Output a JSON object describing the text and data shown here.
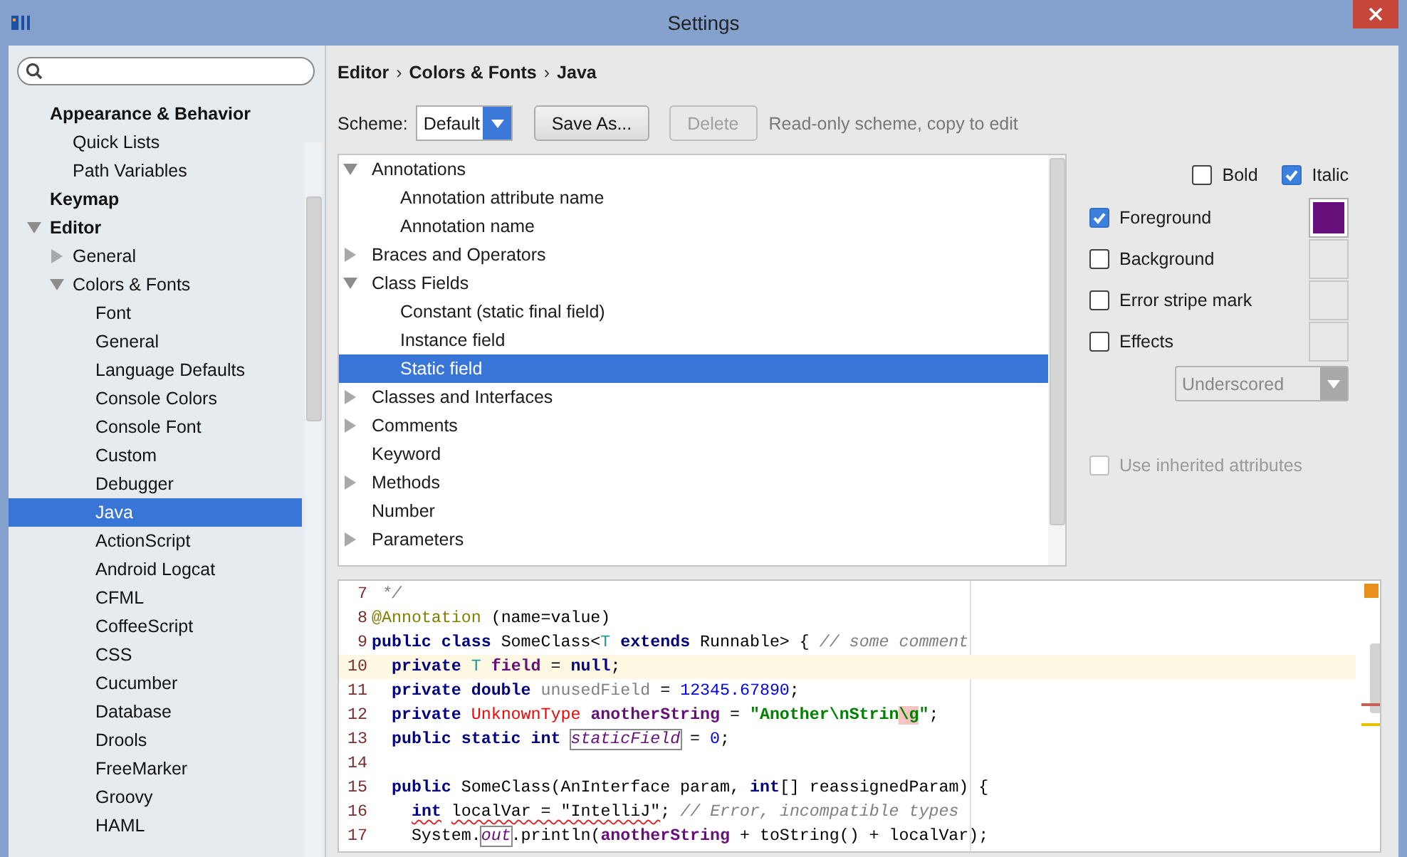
{
  "window": {
    "title": "Settings"
  },
  "sidebar": {
    "items": [
      {
        "label": "Appearance & Behavior",
        "selected": false,
        "children": [
          {
            "label": "Quick Lists",
            "selected": false
          },
          {
            "label": "Path Variables",
            "selected": false
          }
        ]
      },
      {
        "label": "Keymap",
        "selected": false
      },
      {
        "label": "Editor",
        "selected": false,
        "expanded": true,
        "children": [
          {
            "label": "General",
            "selected": false,
            "expanded": false
          },
          {
            "label": "Colors & Fonts",
            "selected": false,
            "expanded": true,
            "children": [
              {
                "label": "Font",
                "selected": false
              },
              {
                "label": "General",
                "selected": false
              },
              {
                "label": "Language Defaults",
                "selected": false
              },
              {
                "label": "Console Colors",
                "selected": false
              },
              {
                "label": "Console Font",
                "selected": false
              },
              {
                "label": "Custom",
                "selected": false
              },
              {
                "label": "Debugger",
                "selected": false
              },
              {
                "label": "Java",
                "selected": true
              },
              {
                "label": "ActionScript",
                "selected": false
              },
              {
                "label": "Android Logcat",
                "selected": false
              },
              {
                "label": "CFML",
                "selected": false
              },
              {
                "label": "CoffeeScript",
                "selected": false
              },
              {
                "label": "CSS",
                "selected": false
              },
              {
                "label": "Cucumber",
                "selected": false
              },
              {
                "label": "Database",
                "selected": false
              },
              {
                "label": "Drools",
                "selected": false
              },
              {
                "label": "FreeMarker",
                "selected": false
              },
              {
                "label": "Groovy",
                "selected": false
              },
              {
                "label": "HAML",
                "selected": false
              }
            ]
          }
        ]
      }
    ]
  },
  "breadcrumb": {
    "items": [
      "Editor",
      "Colors & Fonts",
      "Java"
    ],
    "separator": "›"
  },
  "scheme": {
    "label": "Scheme:",
    "value": "Default",
    "buttons": [
      {
        "label": "Save As...",
        "disabled": false
      },
      {
        "label": "Delete",
        "disabled": true
      }
    ],
    "hint": "Read-only scheme, copy to edit"
  },
  "attribute_tree": {
    "items": [
      {
        "label": "Annotations",
        "selected": false,
        "expanded": true,
        "children": [
          {
            "label": "Annotation attribute name",
            "selected": false
          },
          {
            "label": "Annotation name",
            "selected": false
          }
        ]
      },
      {
        "label": "Braces and Operators",
        "selected": false,
        "expanded": false
      },
      {
        "label": "Class Fields",
        "selected": false,
        "expanded": true,
        "children": [
          {
            "label": "Constant (static final field)",
            "selected": false
          },
          {
            "label": "Instance field",
            "selected": false
          },
          {
            "label": "Static field",
            "selected": true
          }
        ]
      },
      {
        "label": "Classes and Interfaces",
        "selected": false,
        "expanded": false
      },
      {
        "label": "Comments",
        "selected": false,
        "expanded": false
      },
      {
        "label": "Keyword",
        "selected": false
      },
      {
        "label": "Methods",
        "selected": false,
        "expanded": false
      },
      {
        "label": "Number",
        "selected": false
      },
      {
        "label": "Parameters",
        "selected": false,
        "expanded": false
      }
    ]
  },
  "attributes": {
    "bold": {
      "label": "Bold",
      "checked": false
    },
    "italic": {
      "label": "Italic",
      "checked": true
    },
    "colors": [
      {
        "label": "Foreground",
        "checked": true,
        "color": "#660e7a"
      },
      {
        "label": "Background",
        "checked": false
      },
      {
        "label": "Error stripe mark",
        "checked": false
      },
      {
        "label": "Effects",
        "checked": false
      }
    ],
    "effect_type": {
      "value": "Underscored",
      "disabled": true
    },
    "inherit": {
      "label": "Use inherited attributes",
      "checked": false,
      "disabled": true
    }
  },
  "preview": {
    "lines": [
      {
        "number": "7",
        "current": false,
        "segments": [
          {
            "text": " */",
            "kind": "comment"
          }
        ]
      },
      {
        "number": "8",
        "current": false,
        "segments": [
          {
            "text": "@Annotation",
            "kind": "annotation"
          },
          {
            "text": " (name=value)",
            "kind": "plain"
          }
        ]
      },
      {
        "number": "9",
        "current": false,
        "segments": [
          {
            "text": "public class ",
            "kind": "keyword"
          },
          {
            "text": "SomeClass<",
            "kind": "plain"
          },
          {
            "text": "T",
            "kind": "type-param"
          },
          {
            "text": " extends ",
            "kind": "keyword"
          },
          {
            "text": "Runnable> { ",
            "kind": "plain"
          },
          {
            "text": "// some comment",
            "kind": "comment"
          }
        ]
      },
      {
        "number": "10",
        "current": true,
        "segments": [
          {
            "text": "  private ",
            "kind": "keyword"
          },
          {
            "text": "T ",
            "kind": "type-param"
          },
          {
            "text": "field",
            "kind": "field"
          },
          {
            "text": " = ",
            "kind": "plain"
          },
          {
            "text": "null",
            "kind": "keyword"
          },
          {
            "text": ";",
            "kind": "plain"
          }
        ]
      },
      {
        "number": "11",
        "current": false,
        "segments": [
          {
            "text": "  private double ",
            "kind": "keyword"
          },
          {
            "text": "unusedField",
            "kind": "unused"
          },
          {
            "text": " = ",
            "kind": "plain"
          },
          {
            "text": "12345.67890",
            "kind": "number"
          },
          {
            "text": ";",
            "kind": "plain"
          }
        ]
      },
      {
        "number": "12",
        "current": false,
        "segments": [
          {
            "text": "  private ",
            "kind": "keyword"
          },
          {
            "text": "UnknownType ",
            "kind": "unknown"
          },
          {
            "text": "anotherString",
            "kind": "field"
          },
          {
            "text": " = ",
            "kind": "plain"
          },
          {
            "text": "\"Another\\nStrin",
            "kind": "string"
          },
          {
            "text": "\\g",
            "kind": "bad-escape"
          },
          {
            "text": "\"",
            "kind": "string"
          },
          {
            "text": ";",
            "kind": "plain"
          }
        ]
      },
      {
        "number": "13",
        "current": false,
        "segments": [
          {
            "text": "  public static int ",
            "kind": "keyword"
          },
          {
            "text": "staticField",
            "kind": "static-field",
            "boxed": true
          },
          {
            "text": " = ",
            "kind": "plain"
          },
          {
            "text": "0",
            "kind": "number"
          },
          {
            "text": ";",
            "kind": "plain"
          }
        ]
      },
      {
        "number": "14",
        "current": false
      },
      {
        "number": "15",
        "current": false,
        "segments": [
          {
            "text": "  public ",
            "kind": "keyword"
          },
          {
            "text": "SomeClass(AnInterface param, ",
            "kind": "plain"
          },
          {
            "text": "int",
            "kind": "keyword"
          },
          {
            "text": "[] reassignedParam) {",
            "kind": "plain"
          }
        ]
      },
      {
        "number": "16",
        "current": false,
        "segments": [
          {
            "text": "    int",
            "kind": "keyword",
            "error": true
          },
          {
            "text": " localVar = \"IntelliJ\"",
            "kind": "plain",
            "error": true
          },
          {
            "text": "; ",
            "kind": "plain"
          },
          {
            "text": "// Error, incompatible types",
            "kind": "comment"
          }
        ]
      },
      {
        "number": "17",
        "current": false,
        "segments": [
          {
            "text": "    System.",
            "kind": "plain"
          },
          {
            "text": "out",
            "kind": "static-field",
            "boxed": true
          },
          {
            "text": ".println(",
            "kind": "plain"
          },
          {
            "text": "anotherString",
            "kind": "field"
          },
          {
            "text": " + toString() + localVar);",
            "kind": "plain"
          }
        ]
      }
    ]
  }
}
